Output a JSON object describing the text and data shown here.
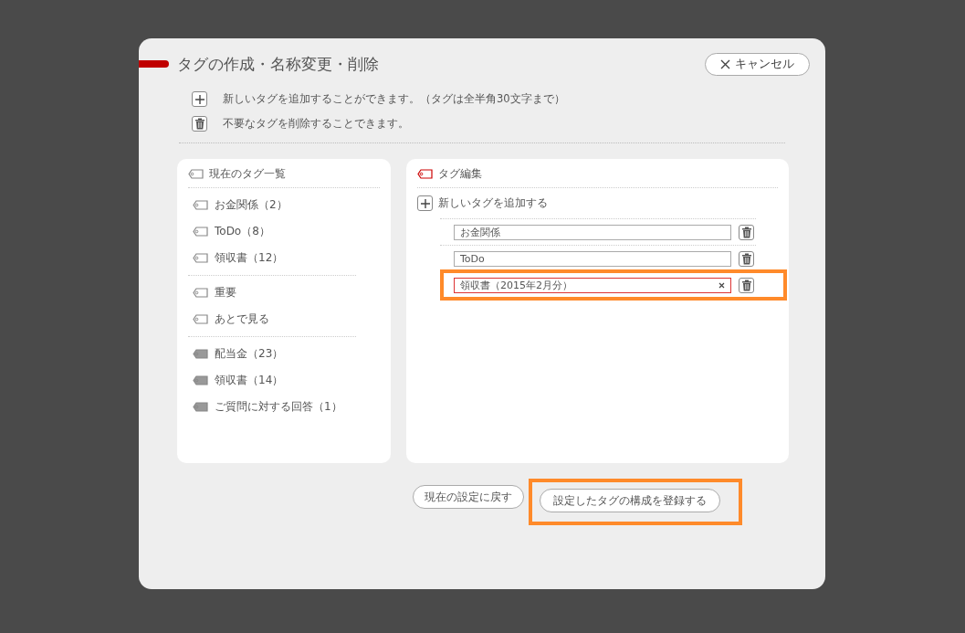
{
  "dialog": {
    "title": "タグの作成・名称変更・削除",
    "cancel_button": "キャンセル",
    "hints": [
      {
        "kind": "add",
        "text": "新しいタグを追加することができます。（タグは全半角30文字まで）"
      },
      {
        "kind": "delete",
        "text": "不要なタグを削除することできます。"
      }
    ]
  },
  "tag_list": {
    "title": "現在のタグ一覧",
    "groups": [
      {
        "kind": "outline",
        "items": [
          "お金関係（2）",
          "ToDo（8）",
          "領収書（12）"
        ]
      },
      {
        "kind": "outline",
        "items": [
          "重要",
          "あとで見る"
        ]
      },
      {
        "kind": "filled",
        "items": [
          "配当金（23）",
          "領収書（14）",
          "ご質問に対する回答（1）"
        ]
      }
    ]
  },
  "tag_editor": {
    "title": "タグ編集",
    "add_label": "新しいタグを追加する",
    "rows": [
      {
        "value": "お金関係",
        "focused": false,
        "highlighted": false
      },
      {
        "value": "ToDo",
        "focused": false,
        "highlighted": false
      },
      {
        "value": "領収書（2015年2月分）",
        "focused": true,
        "highlighted": true
      }
    ]
  },
  "buttons": [
    {
      "label": "現在の設定に戻す",
      "highlighted": false
    },
    {
      "label": "設定したタグの構成を登録する",
      "highlighted": true
    }
  ]
}
